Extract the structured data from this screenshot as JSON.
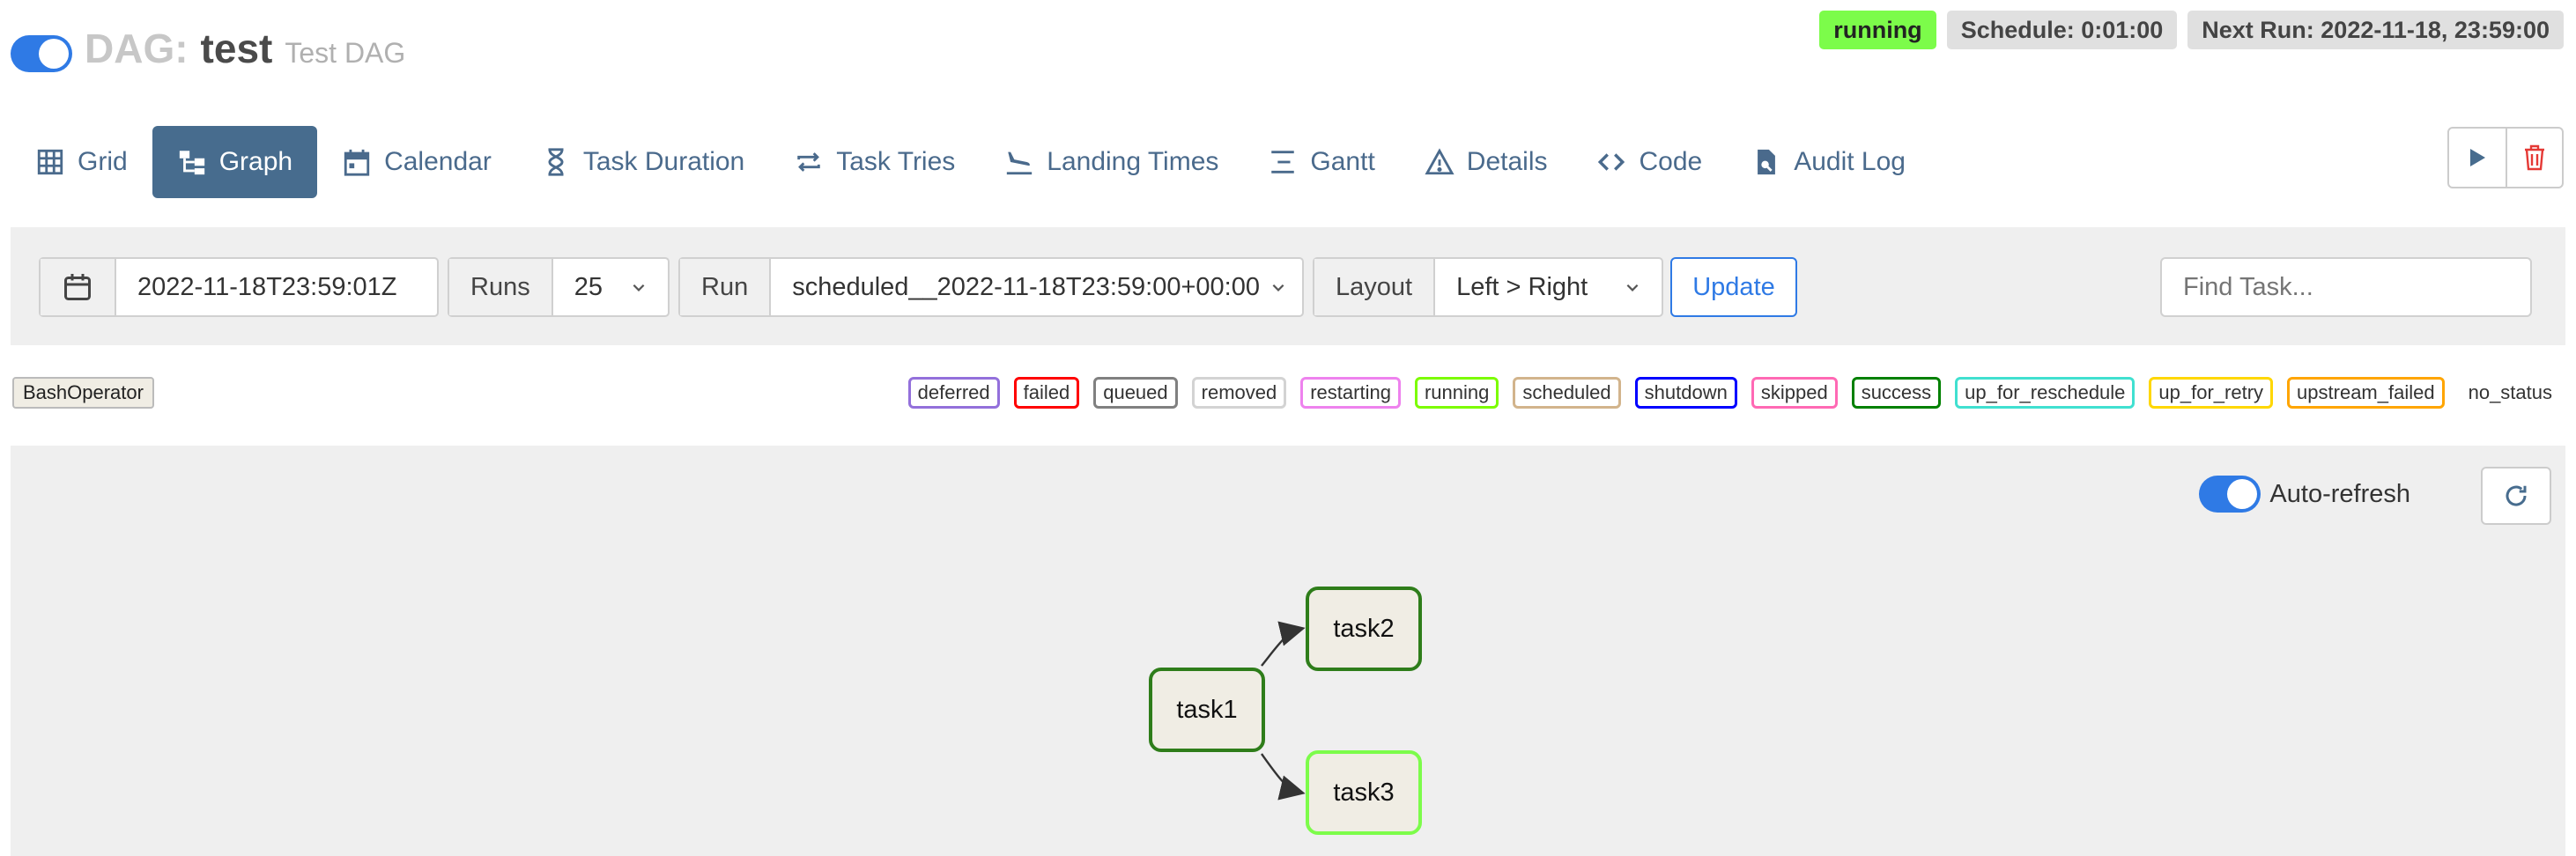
{
  "header": {
    "prefix": "DAG:",
    "dag_id": "test",
    "description": "Test DAG",
    "status": "running",
    "schedule": "Schedule: 0:01:00",
    "next_run": "Next Run: 2022-11-18, 23:59:00"
  },
  "nav": {
    "tabs": [
      {
        "label": "Grid",
        "icon": "grid-icon"
      },
      {
        "label": "Graph",
        "icon": "graph-icon",
        "active": true
      },
      {
        "label": "Calendar",
        "icon": "calendar-icon"
      },
      {
        "label": "Task Duration",
        "icon": "hourglass-icon"
      },
      {
        "label": "Task Tries",
        "icon": "retry-icon"
      },
      {
        "label": "Landing Times",
        "icon": "landing-icon"
      },
      {
        "label": "Gantt",
        "icon": "gantt-icon"
      },
      {
        "label": "Details",
        "icon": "warning-triangle-icon"
      },
      {
        "label": "Code",
        "icon": "code-icon"
      },
      {
        "label": "Audit Log",
        "icon": "file-search-icon"
      }
    ]
  },
  "controls": {
    "base_date": "2022-11-18T23:59:01Z",
    "runs_label": "Runs",
    "runs_value": "25",
    "run_label": "Run",
    "run_value": "scheduled__2022-11-18T23:59:00+00:00",
    "layout_label": "Layout",
    "layout_value": "Left > Right",
    "update_label": "Update",
    "find_placeholder": "Find Task..."
  },
  "legend": {
    "operator": "BashOperator",
    "states": [
      {
        "label": "deferred",
        "color": "#9370db"
      },
      {
        "label": "failed",
        "color": "#ff0000"
      },
      {
        "label": "queued",
        "color": "#808080"
      },
      {
        "label": "removed",
        "color": "#d3d3d3"
      },
      {
        "label": "restarting",
        "color": "#ee82ee"
      },
      {
        "label": "running",
        "color": "#7cfc00"
      },
      {
        "label": "scheduled",
        "color": "#d2b48c"
      },
      {
        "label": "shutdown",
        "color": "#0000ff"
      },
      {
        "label": "skipped",
        "color": "#ff69b4"
      },
      {
        "label": "success",
        "color": "#008000"
      },
      {
        "label": "up_for_reschedule",
        "color": "#40e0d0"
      },
      {
        "label": "up_for_retry",
        "color": "#ffd700"
      },
      {
        "label": "upstream_failed",
        "color": "#ffa500"
      },
      {
        "label": "no_status",
        "color": "transparent"
      }
    ]
  },
  "graph": {
    "auto_refresh_label": "Auto-refresh",
    "nodes": [
      {
        "id": "task1",
        "label": "task1",
        "state": "success",
        "color": "#2e7d1a"
      },
      {
        "id": "task2",
        "label": "task2",
        "state": "success",
        "color": "#2e7d1a"
      },
      {
        "id": "task3",
        "label": "task3",
        "state": "running",
        "color": "#7cfc4a"
      }
    ],
    "edges": [
      {
        "from": "task1",
        "to": "task2"
      },
      {
        "from": "task1",
        "to": "task3"
      }
    ]
  }
}
